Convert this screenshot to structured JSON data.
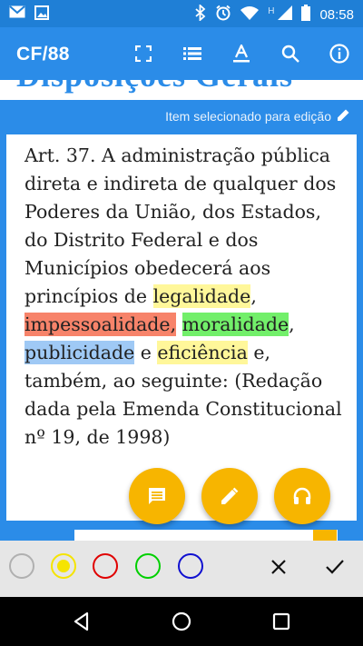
{
  "status_bar": {
    "time": "08:58",
    "icons": [
      "gmail-icon",
      "image-icon",
      "bluetooth-icon",
      "alarm-icon",
      "wifi-icon",
      "signal-h-icon",
      "signal-icon",
      "battery-icon"
    ],
    "network_letter": "H"
  },
  "app_bar": {
    "title": "CF/88",
    "actions": [
      "fullscreen-icon",
      "list-icon",
      "text-format-icon",
      "search-icon",
      "info-icon"
    ]
  },
  "background_heading": "Disposições Gerais",
  "editor": {
    "caption": "Item selecionado para edição",
    "article": {
      "part1": "Art. 37. A administração pública direta e indireta de qualquer dos Poderes da União, dos Estados, do Distrito Federal e dos Municípios obedecerá aos princípios de ",
      "legalidade": "legalidade",
      "comma1": ", ",
      "impessoalidade": "impessoalidade,",
      "space1": " ",
      "moralidade": "moralidade",
      "comma2": ", ",
      "publicidade": "publicidade",
      "and": " e ",
      "eficiencia": "eficiência",
      "part2": " e, também, ao seguinte:   (Redação dada pela Emenda Constitucional nº 19, de 1998)"
    },
    "highlight_colors": {
      "legalidade": "#fff79a",
      "impessoalidade": "#f7836a",
      "moralidade": "#72ef6a",
      "publicidade": "#9fc9f5",
      "eficiencia": "#fff79a"
    },
    "fabs": [
      "comment-icon",
      "edit-pencil-icon",
      "headphones-icon"
    ]
  },
  "palette": {
    "colors": [
      {
        "name": "white",
        "border": "#b0b0b0"
      },
      {
        "name": "yellow",
        "border": "#f5e400",
        "selected": true
      },
      {
        "name": "red",
        "border": "#e00000"
      },
      {
        "name": "green",
        "border": "#00d000"
      },
      {
        "name": "blue",
        "border": "#1010d0"
      }
    ],
    "actions": [
      "close-icon",
      "check-icon"
    ]
  },
  "nav_bar": [
    "back-icon",
    "home-icon",
    "recents-icon"
  ]
}
